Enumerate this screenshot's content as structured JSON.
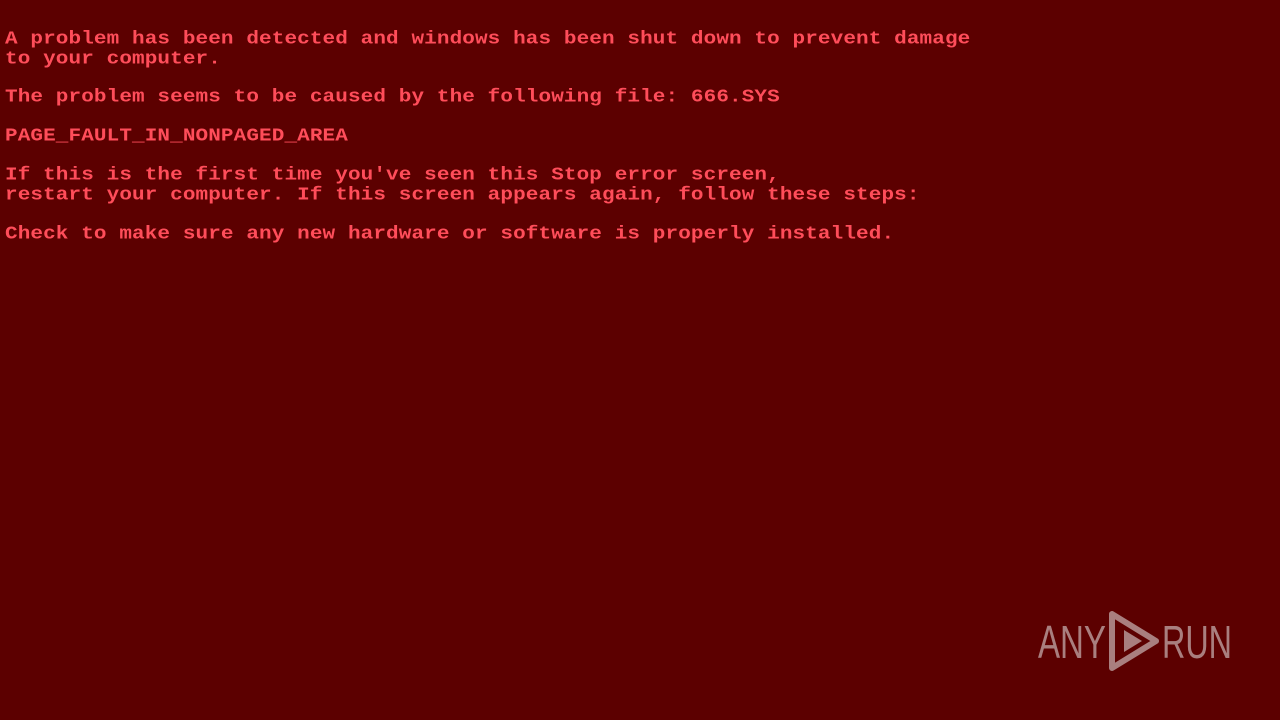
{
  "screen": {
    "background_color": "#5c0000",
    "text_color": "#ff4d5a"
  },
  "error": {
    "line1": "A problem has been detected and windows has been shut down to prevent damage",
    "line2": "to your computer.",
    "line3": "The problem seems to be caused by the following file: 666.SYS",
    "line4": "PAGE_FAULT_IN_NONPAGED_AREA",
    "line5": "If this is the first time you've seen this Stop error screen,",
    "line6": "restart your computer. If this screen appears again, follow these steps:",
    "line7": "Check to make sure any new hardware or software is properly installed."
  },
  "watermark": {
    "text_left": "ANY",
    "text_right": "RUN",
    "icon": "play-triangle-icon"
  }
}
